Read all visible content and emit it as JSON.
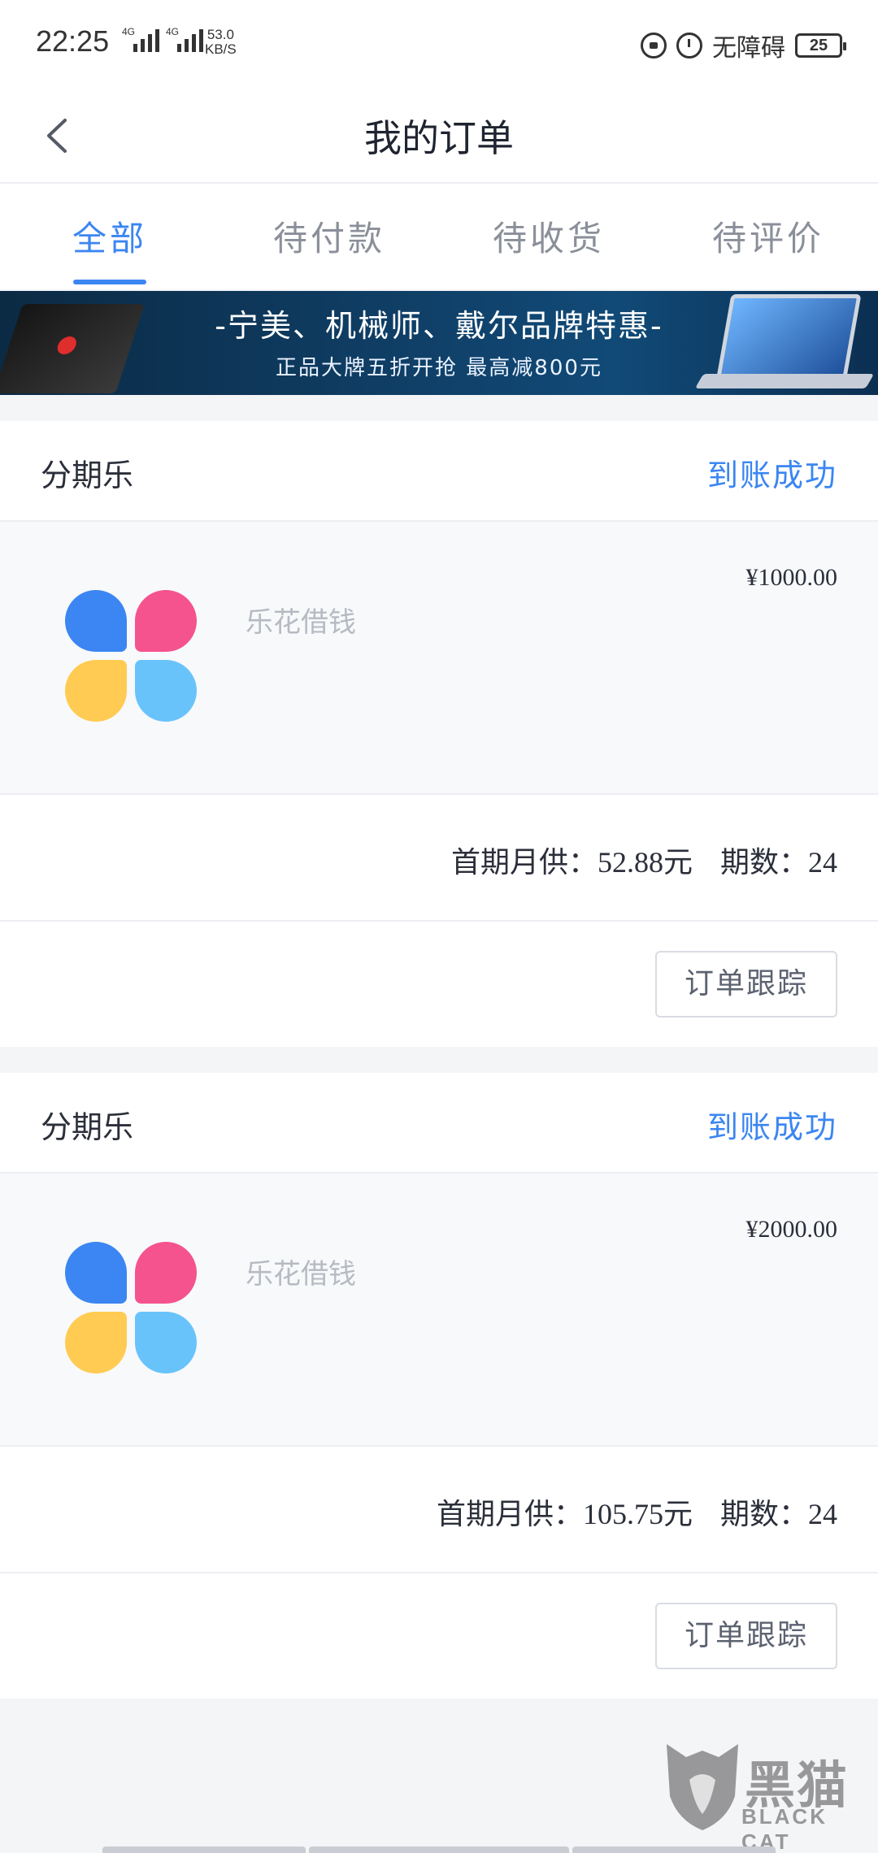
{
  "status_bar": {
    "time": "22:25",
    "network_1": "4G",
    "network_2": "4G",
    "speed_value": "53.0",
    "speed_unit": "KB/S",
    "accessibility": "无障碍",
    "battery": "25"
  },
  "header": {
    "title": "我的订单",
    "back_icon": "chevron-left-icon"
  },
  "tabs": [
    {
      "label": "全部",
      "active": true
    },
    {
      "label": "待付款",
      "active": false
    },
    {
      "label": "待收货",
      "active": false
    },
    {
      "label": "待评价",
      "active": false
    }
  ],
  "banner": {
    "title": "-宁美、机械师、戴尔品牌特惠-",
    "subtitle": "正品大牌五折开抢 最高减800元"
  },
  "orders": [
    {
      "merchant": "分期乐",
      "status": "到账成功",
      "product_name": "乐花借钱",
      "price": "¥1000.00",
      "monthly_label": "首期月供：",
      "monthly_value": "52.88元",
      "periods_label": "期数：",
      "periods_value": "24",
      "track_button": "订单跟踪"
    },
    {
      "merchant": "分期乐",
      "status": "到账成功",
      "product_name": "乐花借钱",
      "price": "¥2000.00",
      "monthly_label": "首期月供：",
      "monthly_value": "105.75元",
      "periods_label": "期数：",
      "periods_value": "24",
      "track_button": "订单跟踪"
    }
  ],
  "watermark": {
    "text": "黑猫",
    "sub": "BLACK CAT"
  },
  "colors": {
    "accent": "#3b86f2",
    "logo_blue": "#3b86f2",
    "logo_pink": "#f5538e",
    "logo_yellow": "#ffcb52",
    "logo_light_blue": "#69c3fb"
  }
}
